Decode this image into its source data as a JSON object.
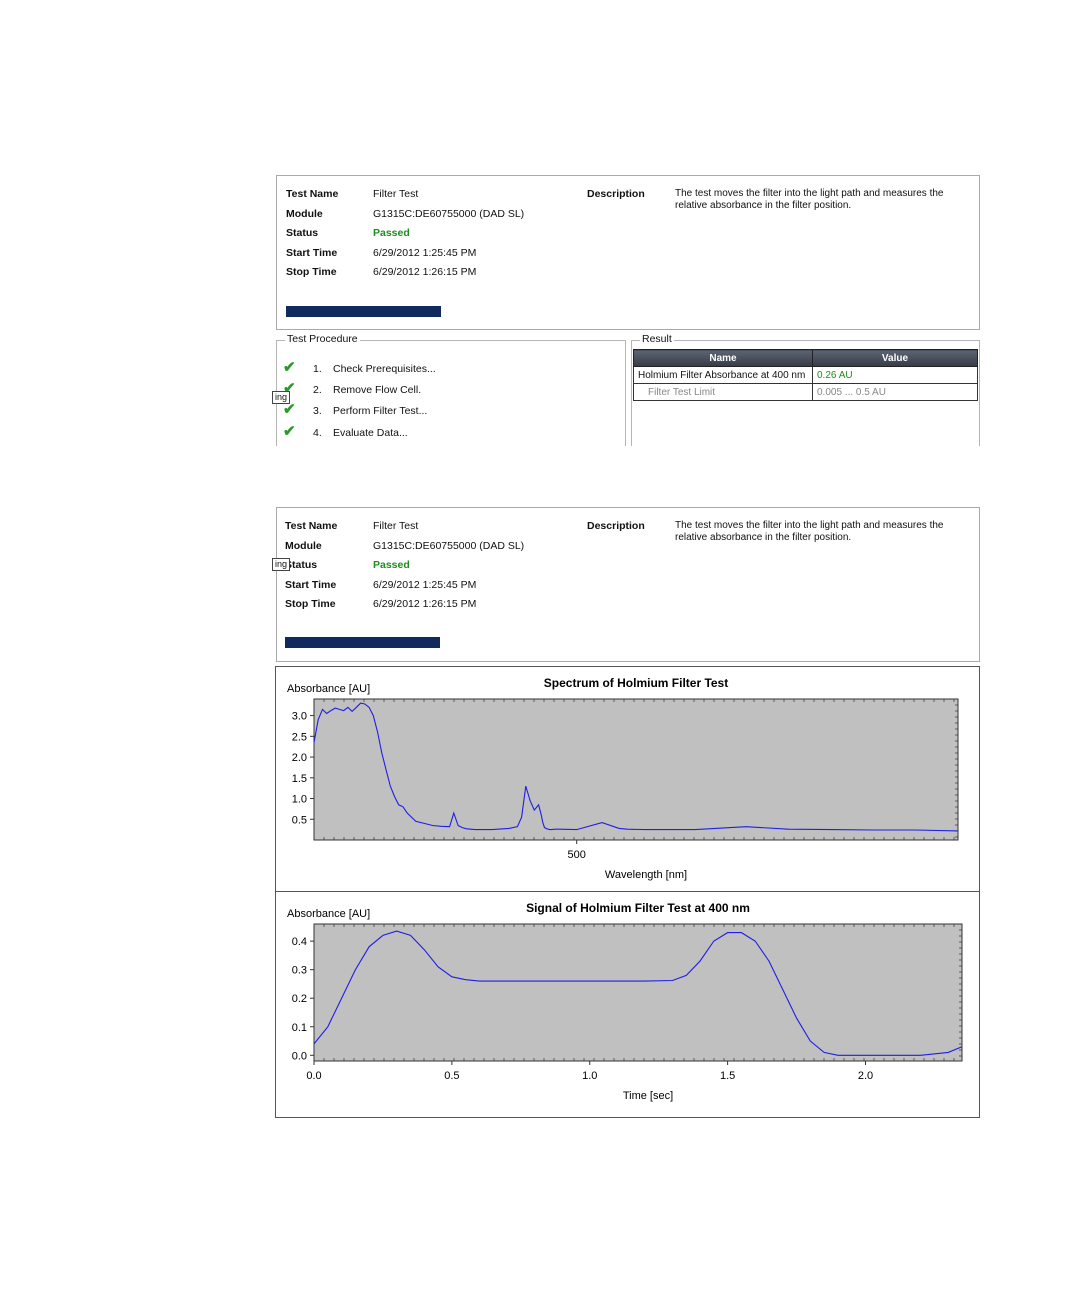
{
  "info": {
    "labels": {
      "test_name": "Test Name",
      "module": "Module",
      "status": "Status",
      "start_time": "Start Time",
      "stop_time": "Stop Time",
      "description": "Description"
    },
    "test_name": "Filter Test",
    "module": "G1315C:DE60755000 (DAD SL)",
    "status": "Passed",
    "start_time": "6/29/2012 1:25:45 PM",
    "stop_time": "6/29/2012 1:26:15 PM",
    "description": "The test moves the filter into the light path and measures the relative absorbance in the filter position.",
    "status_color": "#1e8c1e",
    "progress_color": "#102a5e"
  },
  "tooltip_fragment": "ing",
  "procedure": {
    "title": "Test Procedure",
    "icon": "check-icon",
    "steps": [
      {
        "num": "1.",
        "label": "Check Prerequisites..."
      },
      {
        "num": "2.",
        "label": "Remove Flow Cell."
      },
      {
        "num": "3.",
        "label": "Perform Filter Test..."
      },
      {
        "num": "4.",
        "label": "Evaluate Data..."
      }
    ]
  },
  "result": {
    "title": "Result",
    "headers": [
      "Name",
      "Value"
    ],
    "rows": [
      {
        "name": "Holmium Filter Absorbance at 400 nm",
        "value": "0.26 AU"
      },
      {
        "name": "Filter Test Limit",
        "value": "0.005 ... 0.5 AU"
      }
    ]
  },
  "chart_data": [
    {
      "type": "line",
      "title": "Spectrum of Holmium Filter Test",
      "ylabel": "Absorbance [AU]",
      "xlabel": "Wavelength [nm]",
      "xlim": [
        190,
        950
      ],
      "ylim": [
        0.0,
        3.4
      ],
      "yticks": [
        0.5,
        1.0,
        1.5,
        2.0,
        2.5,
        3.0
      ],
      "xticks": [
        500
      ],
      "grid": false,
      "x": [
        190,
        195,
        200,
        205,
        210,
        215,
        220,
        225,
        230,
        235,
        240,
        245,
        250,
        255,
        260,
        265,
        270,
        275,
        280,
        285,
        290,
        295,
        300,
        310,
        320,
        330,
        340,
        350,
        355,
        360,
        365,
        370,
        380,
        400,
        420,
        430,
        435,
        440,
        445,
        450,
        455,
        458,
        460,
        462,
        465,
        468,
        470,
        475,
        480,
        500,
        530,
        550,
        560,
        580,
        600,
        640,
        700,
        750,
        800,
        850,
        900,
        950
      ],
      "values": [
        2.35,
        2.9,
        3.15,
        3.05,
        3.12,
        3.18,
        3.15,
        3.12,
        3.2,
        3.1,
        3.2,
        3.3,
        3.28,
        3.2,
        3.0,
        2.6,
        2.1,
        1.7,
        1.3,
        1.05,
        0.85,
        0.8,
        0.65,
        0.45,
        0.4,
        0.35,
        0.33,
        0.32,
        0.65,
        0.35,
        0.3,
        0.27,
        0.25,
        0.25,
        0.28,
        0.32,
        0.55,
        1.3,
        0.95,
        0.72,
        0.85,
        0.62,
        0.42,
        0.3,
        0.27,
        0.25,
        0.25,
        0.26,
        0.26,
        0.25,
        0.42,
        0.28,
        0.26,
        0.25,
        0.25,
        0.25,
        0.32,
        0.26,
        0.25,
        0.24,
        0.24,
        0.22
      ]
    },
    {
      "type": "line",
      "title": "Signal of Holmium Filter Test at 400 nm",
      "ylabel": "Absorbance [AU]",
      "xlabel": "Time [sec]",
      "xlim": [
        0.0,
        2.35
      ],
      "ylim": [
        -0.02,
        0.46
      ],
      "yticks": [
        0.0,
        0.1,
        0.2,
        0.3,
        0.4
      ],
      "xticks": [
        0.0,
        0.5,
        1.0,
        1.5,
        2.0
      ],
      "xtick_labels": [
        "0.0",
        "0.5",
        "1.0",
        "1.5",
        "2.0"
      ],
      "ytick_labels": [
        "0.0",
        "0.1",
        "0.2",
        "0.3",
        "0.4"
      ],
      "grid": false,
      "x": [
        0.0,
        0.05,
        0.1,
        0.15,
        0.2,
        0.25,
        0.3,
        0.35,
        0.4,
        0.45,
        0.5,
        0.55,
        0.6,
        0.7,
        0.8,
        1.0,
        1.2,
        1.3,
        1.35,
        1.4,
        1.45,
        1.5,
        1.55,
        1.6,
        1.65,
        1.7,
        1.75,
        1.8,
        1.85,
        1.9,
        2.0,
        2.1,
        2.2,
        2.3,
        2.35
      ],
      "values": [
        0.04,
        0.1,
        0.2,
        0.3,
        0.38,
        0.42,
        0.435,
        0.42,
        0.37,
        0.31,
        0.275,
        0.265,
        0.26,
        0.26,
        0.26,
        0.26,
        0.26,
        0.262,
        0.28,
        0.33,
        0.4,
        0.43,
        0.43,
        0.4,
        0.33,
        0.23,
        0.13,
        0.05,
        0.01,
        0.0,
        0.0,
        0.0,
        0.0,
        0.01,
        0.03
      ]
    }
  ],
  "colors": {
    "plot_bg": "#c0c0c0",
    "series": "#1e1ee6"
  }
}
